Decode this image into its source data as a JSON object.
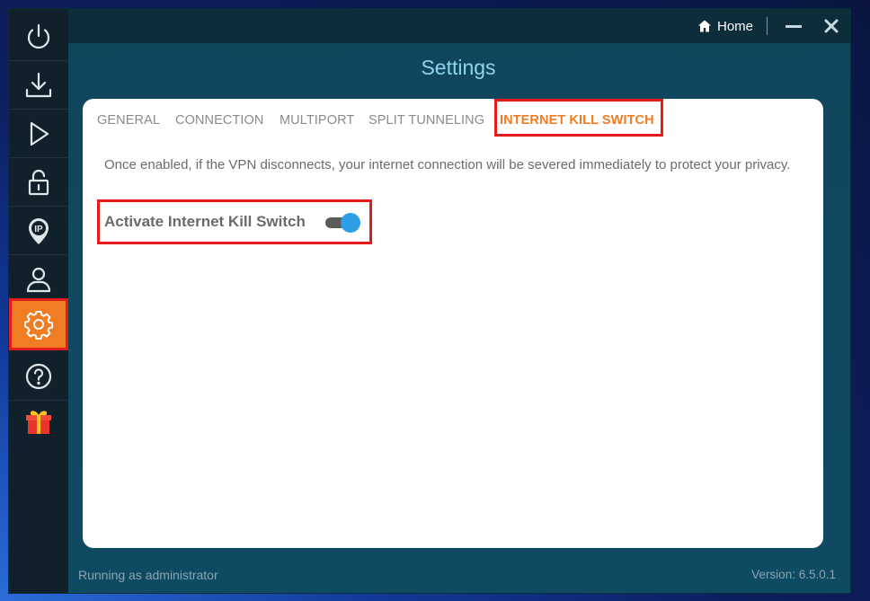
{
  "window": {
    "home_label": "Home",
    "title": "Settings"
  },
  "sidebar": {
    "items": [
      {
        "name": "power-icon"
      },
      {
        "name": "download-icon"
      },
      {
        "name": "play-icon"
      },
      {
        "name": "lock-icon"
      },
      {
        "name": "ip-location-icon"
      },
      {
        "name": "user-icon"
      },
      {
        "name": "gear-icon",
        "active": true
      },
      {
        "name": "help-icon"
      },
      {
        "name": "gift-icon"
      }
    ]
  },
  "tabs": [
    {
      "label": "GENERAL"
    },
    {
      "label": "CONNECTION"
    },
    {
      "label": "MULTIPORT"
    },
    {
      "label": "SPLIT TUNNELING"
    },
    {
      "label": "INTERNET KILL SWITCH",
      "active": true
    }
  ],
  "kill_switch": {
    "description": "Once enabled, if the VPN disconnects, your internet connection will be severed immediately to protect your privacy.",
    "toggle_label": "Activate Internet Kill Switch",
    "enabled": true
  },
  "footer": {
    "status": "Running as administrator",
    "version": "Version:  6.5.0.1"
  },
  "colors": {
    "accent": "#f07d23",
    "toggle_on": "#2d9de6",
    "highlight_box": "#e41b1b"
  }
}
